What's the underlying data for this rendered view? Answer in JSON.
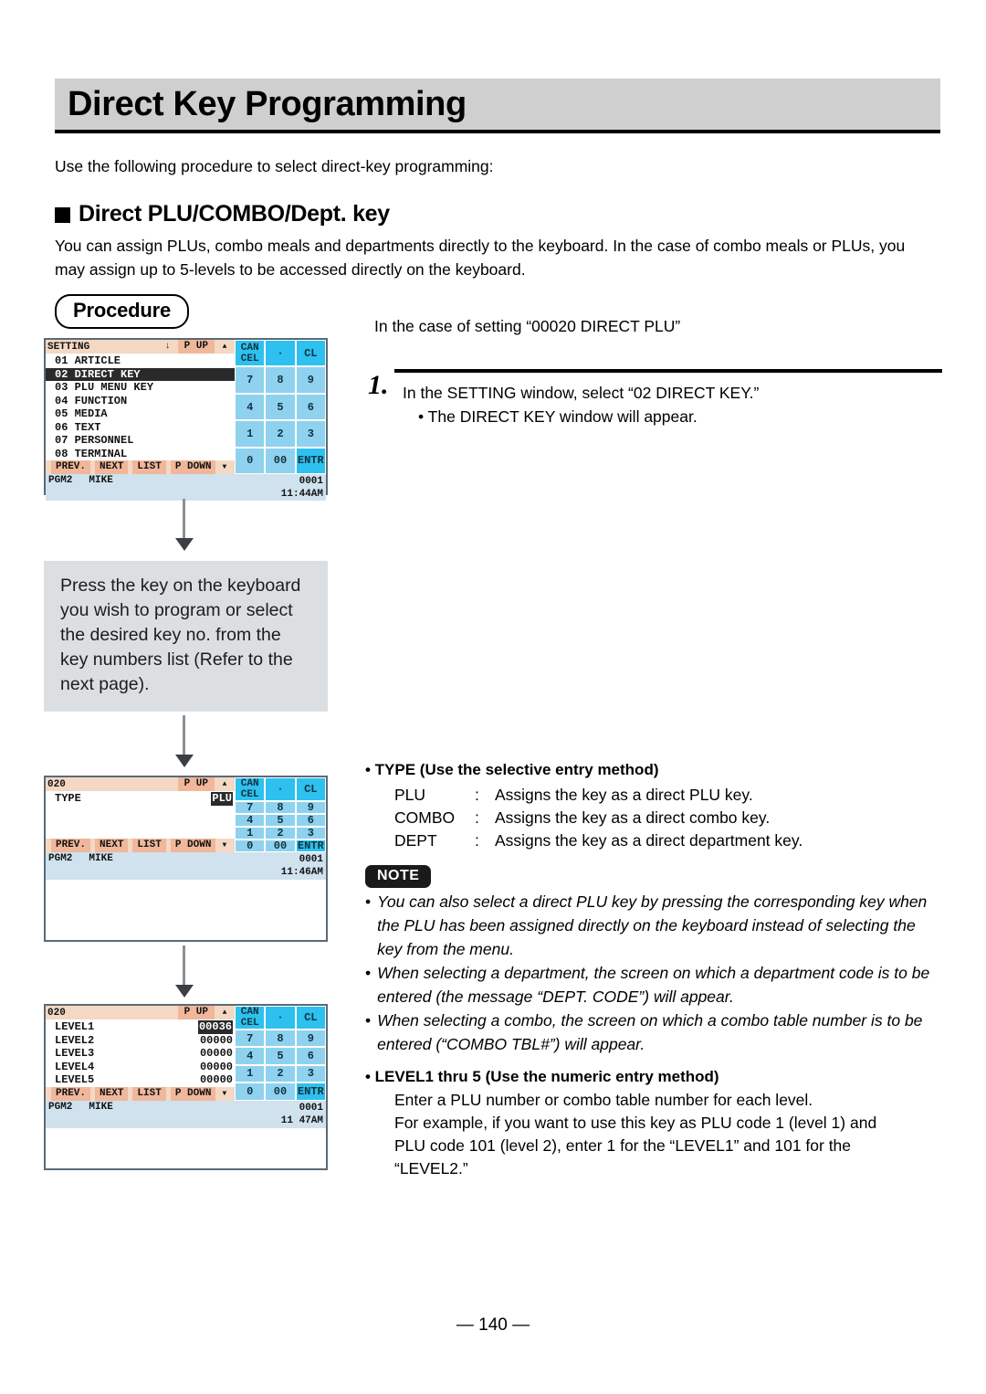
{
  "page": {
    "title": "Direct Key Programming",
    "intro": "Use the following procedure to select direct-key programming:",
    "section_heading": "Direct PLU/COMBO/Dept. key",
    "section_paragraph": "You can assign PLUs, combo meals and departments directly to the keyboard. In the case of combo meals or PLUs, you may assign up to 5-levels to be accessed directly on the keyboard.",
    "procedure_badge": "Procedure",
    "footer": "— 140 —"
  },
  "right": {
    "case_line": "In the case of setting “00020 DIRECT PLU”",
    "step_number": "1.",
    "step_text": "In the SETTING window, select “02 DIRECT KEY.”",
    "step_sub": "• The DIRECT KEY window will appear.",
    "type_heading": "• TYPE (Use the selective entry method)",
    "type_rows": [
      {
        "key": "PLU",
        "colon": ":",
        "desc": "Assigns the key as a direct PLU key."
      },
      {
        "key": "COMBO",
        "colon": ":",
        "desc": "Assigns the key as a direct combo key."
      },
      {
        "key": "DEPT",
        "colon": ":",
        "desc": "Assigns the key as a direct department key."
      }
    ],
    "note_badge": "NOTE",
    "note_bullet": "•",
    "notes": [
      "You can also select a direct PLU key by pressing the corresponding key when the PLU has been assigned directly on the keyboard instead of selecting the key from the menu.",
      "When selecting a department, the screen on which a department code is to be entered (the message “DEPT. CODE”) will appear.",
      "When selecting a combo, the screen on which a combo table number is to be entered (“COMBO TBL#”) will appear."
    ],
    "level_heading": "• LEVEL1 thru 5 (Use the numeric entry method)",
    "level_lines": [
      "Enter a PLU number or combo table number for each level.",
      "For example, if you want to use this key as PLU code 1 (level 1) and",
      "PLU code 101 (level 2), enter 1 for the “LEVEL1” and 101 for the",
      "“LEVEL2.”"
    ]
  },
  "flow": {
    "grey_box_text": "Press the key on the keyboard you wish to program or select the desired key no. from the key numbers list (Refer to the next page)."
  },
  "keypad": {
    "rows": [
      [
        {
          "label": "CAN",
          "label2": "CEL",
          "style": "dark"
        },
        {
          "label": "·",
          "style": "dark"
        },
        {
          "label": "CL",
          "style": "dark"
        }
      ],
      [
        {
          "label": "7",
          "style": "light"
        },
        {
          "label": "8",
          "style": "light"
        },
        {
          "label": "9",
          "style": "light"
        }
      ],
      [
        {
          "label": "4",
          "style": "light"
        },
        {
          "label": "5",
          "style": "light"
        },
        {
          "label": "6",
          "style": "light"
        }
      ],
      [
        {
          "label": "1",
          "style": "light"
        },
        {
          "label": "2",
          "style": "light"
        },
        {
          "label": "3",
          "style": "light"
        }
      ],
      [
        {
          "label": "0",
          "style": "light"
        },
        {
          "label": "00",
          "style": "light"
        },
        {
          "label": "ENTR",
          "style": "dark"
        }
      ]
    ]
  },
  "softkeys": {
    "items": [
      "PREV.",
      "NEXT",
      "LIST",
      "P DOWN"
    ],
    "down_arrow": "▼"
  },
  "screens": [
    {
      "header_title": "SETTING",
      "header_down_arrow": "↓",
      "header_pup": "P UP",
      "header_up_arrow": "▲",
      "rows": [
        {
          "label": "01 ARTICLE",
          "value": "",
          "selected": false
        },
        {
          "label": "02 DIRECT KEY",
          "value": "",
          "selected": true
        },
        {
          "label": "03 PLU MENU KEY",
          "value": "",
          "selected": false
        },
        {
          "label": "04 FUNCTION",
          "value": "",
          "selected": false
        },
        {
          "label": "05 MEDIA",
          "value": "",
          "selected": false
        },
        {
          "label": "06 TEXT",
          "value": "",
          "selected": false
        },
        {
          "label": "07 PERSONNEL",
          "value": "",
          "selected": false
        },
        {
          "label": "08 TERMINAL",
          "value": "",
          "selected": false
        }
      ],
      "status_mode": "PGM2",
      "status_user": "MIKE",
      "status_counter": "0001",
      "status_time": "11:44AM"
    },
    {
      "header_title": "020",
      "header_down_arrow": "",
      "header_pup": "P UP",
      "header_up_arrow": "▲",
      "rows": [
        {
          "label": "TYPE",
          "value": "PLU",
          "selected": false,
          "value_inverse": true
        }
      ],
      "status_mode": "PGM2",
      "status_user": "MIKE",
      "status_counter": "0001",
      "status_time": "11:46AM"
    },
    {
      "header_title": "020",
      "header_down_arrow": "",
      "header_pup": "P UP",
      "header_up_arrow": "▲",
      "rows": [
        {
          "label": "LEVEL1",
          "value": "00036",
          "selected": false,
          "value_inverse": true
        },
        {
          "label": "LEVEL2",
          "value": "00000",
          "selected": false
        },
        {
          "label": "LEVEL3",
          "value": "00000",
          "selected": false
        },
        {
          "label": "LEVEL4",
          "value": "00000",
          "selected": false
        },
        {
          "label": "LEVEL5",
          "value": "00000",
          "selected": false
        }
      ],
      "status_mode": "PGM2",
      "status_user": "MIKE",
      "status_counter": "0001",
      "status_time": "11 47AM"
    }
  ],
  "colors": {
    "title_band": "#cfcfcf",
    "lcd_header": "#f4d8c3",
    "lcd_softkey": "#f0b79b",
    "lcd_status": "#cfe2ee",
    "keypad_light": "#8fd2ef",
    "keypad_dark": "#2ec0ee",
    "selection": "#2a2a2a",
    "grey_box": "#dcdfe1"
  }
}
